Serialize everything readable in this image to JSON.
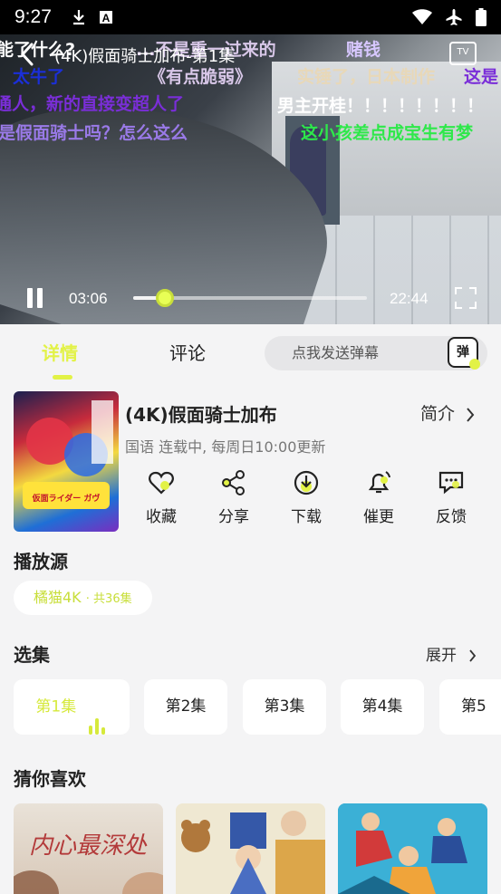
{
  "status_bar": {
    "time": "9:27",
    "left_icons": [
      "download-icon",
      "a-badge-icon"
    ],
    "right_icons": [
      "wifi-icon",
      "airplane-icon",
      "battery-icon"
    ]
  },
  "player": {
    "title": "(4K)假面骑士加布-第1集",
    "tv_label": "TV",
    "current_time": "03:06",
    "total_time": "22:44",
    "progress": 0.137,
    "danmaku": [
      {
        "text": "能了什么?",
        "color": "#ffffff"
      },
      {
        "text": "...不是重一过来的",
        "color": "#d8c7e8"
      },
      {
        "text": "赌钱",
        "color": "#d7c7ff"
      },
      {
        "text": "太牛了",
        "color": "#1b2fd8"
      },
      {
        "text": "《有点脆弱》",
        "color": "#d8c7e8"
      },
      {
        "text": "实锤了，日本制作",
        "color": "#e8d8b8"
      },
      {
        "text": "这是",
        "color": "#7a2ed8"
      },
      {
        "text": "通人，新的直接变超人了",
        "color": "#7a2ed8"
      },
      {
        "text": "男主开桂！！！！！！！！",
        "color": "#ffffff"
      },
      {
        "text": "是假面骑士吗？怎么这么",
        "color": "#9a7ae8"
      },
      {
        "text": "这小孩差点成宝生有梦",
        "color": "#2ee84a"
      }
    ]
  },
  "tabs": [
    {
      "label": "详情",
      "active": true
    },
    {
      "label": "评论",
      "active": false
    }
  ],
  "danmaku_input": {
    "placeholder": "点我发送弹幕",
    "icon_label": "弹"
  },
  "show": {
    "title": "(4K)假面骑士加布",
    "intro_label": "简介",
    "meta": "国语 连载中, 每周日10:00更新",
    "poster_text": "仮面ライダー ガヴ",
    "actions": [
      {
        "label": "收藏",
        "icon": "heart-icon"
      },
      {
        "label": "分享",
        "icon": "share-icon"
      },
      {
        "label": "下载",
        "icon": "download-icon"
      },
      {
        "label": "催更",
        "icon": "bell-icon"
      },
      {
        "label": "反馈",
        "icon": "feedback-icon"
      }
    ]
  },
  "source_section": {
    "heading": "播放源",
    "chip_label": "橘猫4K",
    "chip_count": "· 共36集"
  },
  "episodes_section": {
    "heading": "选集",
    "expand_label": "展开",
    "episodes": [
      {
        "label": "第1集",
        "active": true
      },
      {
        "label": "第2集"
      },
      {
        "label": "第3集"
      },
      {
        "label": "第4集"
      },
      {
        "label": "第5"
      }
    ]
  },
  "recs_section": {
    "heading": "猜你喜欢",
    "items": [
      {
        "poster_text": "内心最深处"
      },
      {
        "poster_text": ""
      },
      {
        "poster_text": ""
      }
    ]
  },
  "colors": {
    "accent": "#e2f246",
    "accent_dark": "#c8de3a",
    "bg": "#f4f4f5"
  }
}
